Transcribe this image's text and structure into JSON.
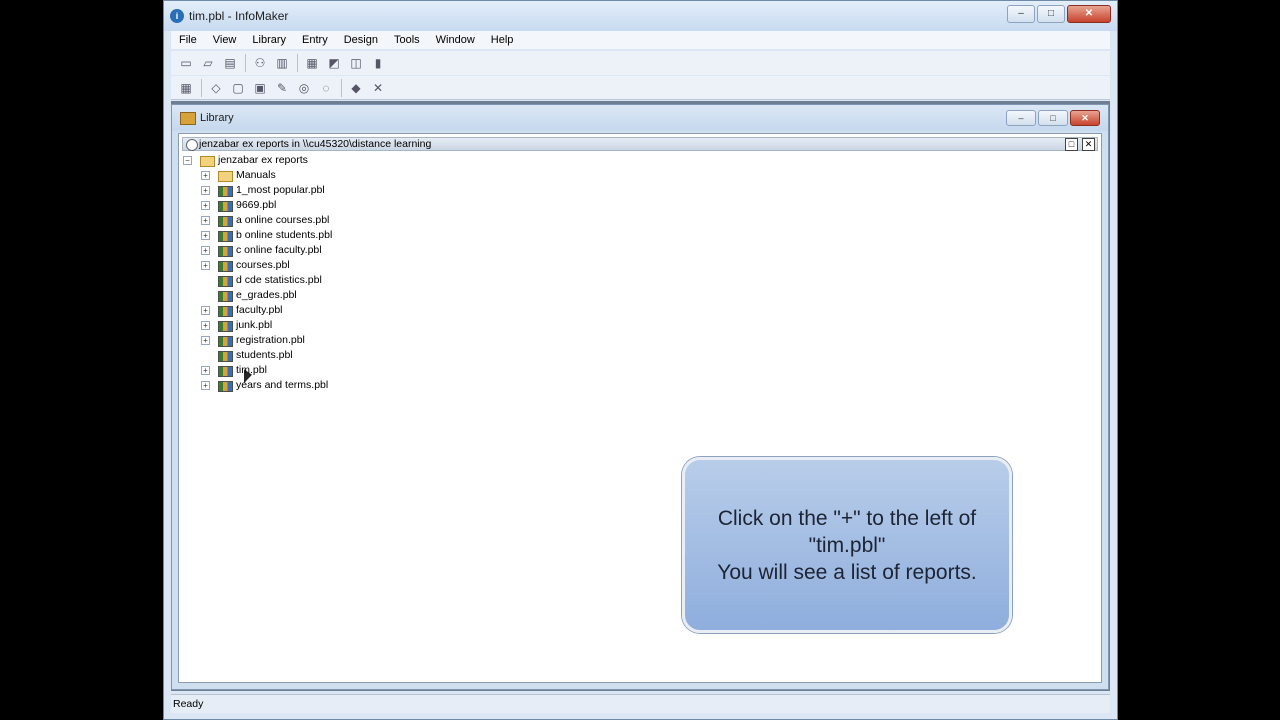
{
  "window": {
    "title": "tim.pbl - InfoMaker",
    "minimize": "–",
    "maximize": "□",
    "close": "✕"
  },
  "menu": [
    "File",
    "View",
    "Library",
    "Entry",
    "Design",
    "Tools",
    "Window",
    "Help"
  ],
  "toolbar1": [
    "new-icon",
    "open-icon",
    "print-preview-icon",
    "compare-icon",
    "library-icon",
    "report-icon",
    "query-icon",
    "database-icon",
    "exit-icon"
  ],
  "toolbar2": [
    "grid-icon",
    "cube-icon",
    "copy-icon",
    "paste-icon",
    "edit-icon",
    "run-icon",
    "preview-icon",
    "package-icon",
    "close-icon"
  ],
  "library": {
    "title": "Library",
    "header": "jenzabar ex reports in \\\\cu45320\\distance learning",
    "root": "jenzabar ex reports",
    "items": [
      {
        "label": "Manuals",
        "type": "folder",
        "expandable": true
      },
      {
        "label": "1_most popular.pbl",
        "type": "pbl",
        "expandable": true
      },
      {
        "label": "9669.pbl",
        "type": "pbl",
        "expandable": true
      },
      {
        "label": "a online courses.pbl",
        "type": "pbl",
        "expandable": true
      },
      {
        "label": "b online students.pbl",
        "type": "pbl",
        "expandable": true
      },
      {
        "label": "c online faculty.pbl",
        "type": "pbl",
        "expandable": true
      },
      {
        "label": "courses.pbl",
        "type": "pbl",
        "expandable": true
      },
      {
        "label": "d cde statistics.pbl",
        "type": "pbl",
        "expandable": false
      },
      {
        "label": "e_grades.pbl",
        "type": "pbl",
        "expandable": false
      },
      {
        "label": "faculty.pbl",
        "type": "pbl",
        "expandable": true
      },
      {
        "label": "junk.pbl",
        "type": "pbl",
        "expandable": true
      },
      {
        "label": "registration.pbl",
        "type": "pbl",
        "expandable": true
      },
      {
        "label": "students.pbl",
        "type": "pbl",
        "expandable": false
      },
      {
        "label": "tim.pbl",
        "type": "pbl",
        "expandable": true
      },
      {
        "label": "years and terms.pbl",
        "type": "pbl",
        "expandable": true
      }
    ]
  },
  "callout": {
    "text": "Click on the \"+\" to the left of \"tim.pbl\"\nYou will see a list of reports."
  },
  "status": {
    "text": "Ready"
  }
}
